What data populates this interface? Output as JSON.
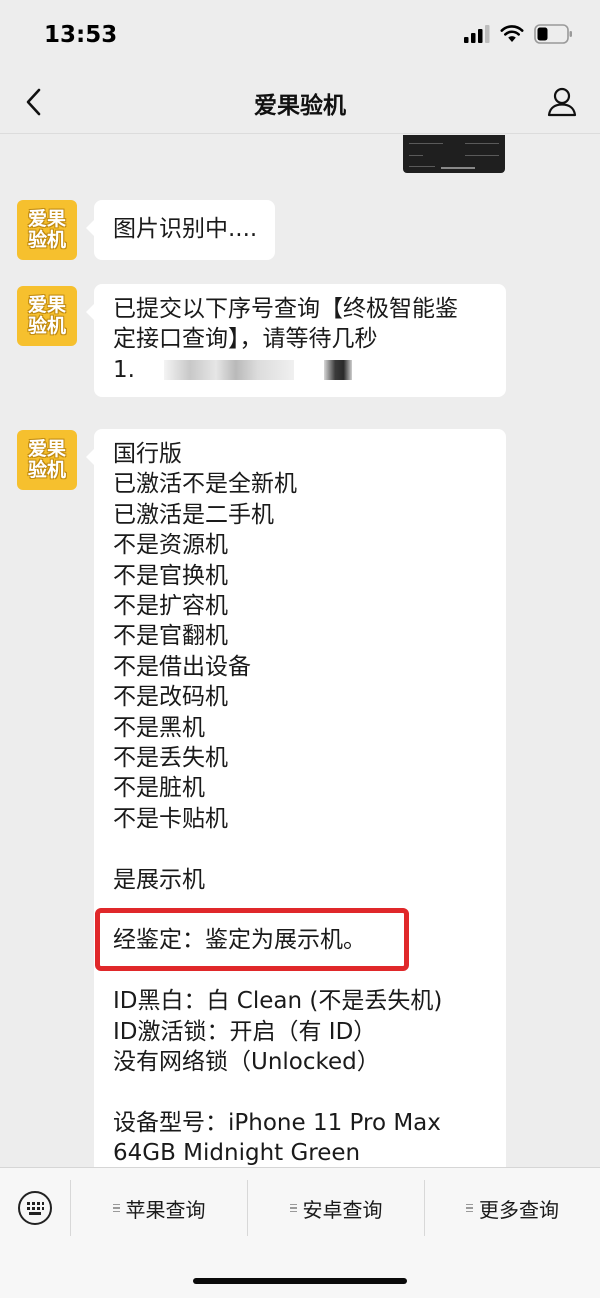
{
  "status_bar": {
    "time": "13:53"
  },
  "nav": {
    "title": "爱果验机"
  },
  "avatar": {
    "line1": "爱果",
    "line2": "验机"
  },
  "messages": [
    {
      "lines": [
        "图片识别中...."
      ]
    },
    {
      "lines": [
        "已提交以下序号查询【终极智能鉴",
        "定接口查询】，请等待几秒"
      ],
      "serial_prefix": "1."
    },
    {
      "lines": [
        "国行版",
        "已激活不是全新机",
        "已激活是二手机",
        "不是资源机",
        "不是官换机",
        "不是扩容机",
        "不是官翻机",
        "不是借出设备",
        "不是改码机",
        "不是黑机",
        "不是丢失机",
        "不是脏机",
        "不是卡贴机",
        "",
        "是展示机",
        "",
        "经鉴定：鉴定为展示机。",
        "",
        "ID黑白：白 Clean (不是丢失机)",
        "ID激活锁：开启（有 ID）",
        "没有网络锁（Unlocked）",
        "",
        "设备型号：iPhone 11 Pro Max",
        "64GB Midnight Green"
      ]
    }
  ],
  "menu": {
    "items": [
      "苹果查询",
      "安卓查询",
      "更多查询"
    ]
  },
  "colors": {
    "accent_red": "#e0282a",
    "avatar_yellow": "#f6c02e",
    "background": "#ededed"
  }
}
